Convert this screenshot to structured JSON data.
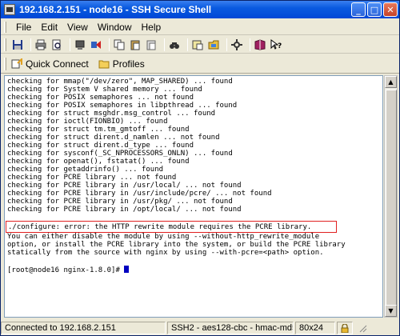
{
  "window": {
    "title": "192.168.2.151 - node16 - SSH Secure Shell",
    "minimize_glyph": "_",
    "maximize_glyph": "□",
    "close_glyph": "✕"
  },
  "menu": {
    "items": [
      "File",
      "Edit",
      "View",
      "Window",
      "Help"
    ]
  },
  "toolbar": {
    "icons": [
      "save-icon",
      "print-icon",
      "print-preview-icon",
      "disconnect-icon",
      "transfer-icon",
      "copy-icon",
      "paste-icon",
      "paste-special-icon",
      "find-icon",
      "settings-icon",
      "new-file-transfer-icon",
      "key-icon",
      "help-book-icon",
      "context-help-icon"
    ]
  },
  "profilebar": {
    "quick_connect": "Quick Connect",
    "profiles": "Profiles"
  },
  "terminal": {
    "lines": [
      "checking for mmap(\"/dev/zero\", MAP_SHARED) ... found",
      "checking for System V shared memory ... found",
      "checking for POSIX semaphores ... not found",
      "checking for POSIX semaphores in libpthread ... found",
      "checking for struct msghdr.msg_control ... found",
      "checking for ioctl(FIONBIO) ... found",
      "checking for struct tm.tm_gmtoff ... found",
      "checking for struct dirent.d_namlen ... not found",
      "checking for struct dirent.d_type ... found",
      "checking for sysconf(_SC_NPROCESSORS_ONLN) ... found",
      "checking for openat(), fstatat() ... found",
      "checking for getaddrinfo() ... found",
      "checking for PCRE library ... not found",
      "checking for PCRE library in /usr/local/ ... not found",
      "checking for PCRE library in /usr/include/pcre/ ... not found",
      "checking for PCRE library in /usr/pkg/ ... not found",
      "checking for PCRE library in /opt/local/ ... not found"
    ],
    "error_line": "./configure: error: the HTTP rewrite module requires the PCRE library.",
    "after_lines": [
      "You can either disable the module by using --without-http_rewrite_module",
      "option, or install the PCRE library into the system, or build the PCRE library",
      "statically from the source with nginx by using --with-pcre=<path> option."
    ],
    "prompt": "[root@node16 nginx-1.8.0]# ",
    "error_highlight_color": "#e02020",
    "cursor_color": "#0000c0"
  },
  "status": {
    "connection": "Connected to 192.168.2.151",
    "cipher": "SSH2 - aes128-cbc - hmac-md5",
    "size": "80x24"
  }
}
